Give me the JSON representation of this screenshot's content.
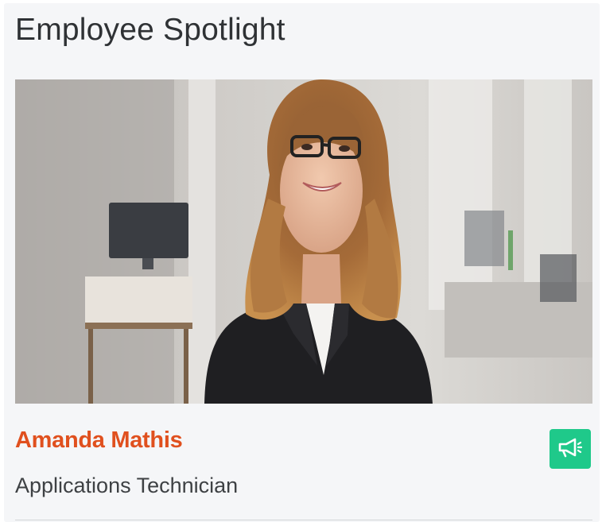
{
  "widget": {
    "title": "Employee Spotlight"
  },
  "employee": {
    "name": "Amanda Mathis",
    "role": "Applications Technician"
  },
  "actions": {
    "announce_icon": "megaphone-icon"
  },
  "colors": {
    "name_accent": "#e0501e",
    "announce_button": "#1fc98a",
    "card_background": "#f5f6f8"
  }
}
